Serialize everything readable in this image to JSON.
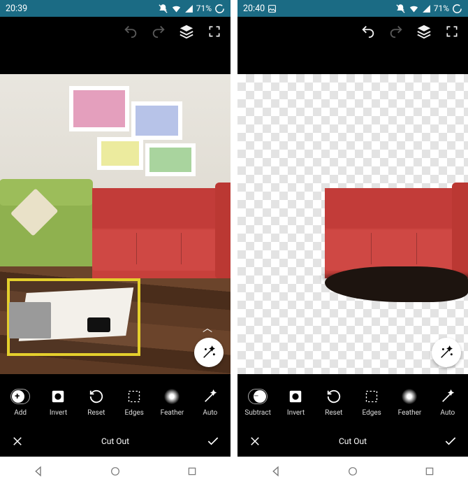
{
  "left": {
    "status": {
      "time": "20:39",
      "battery": "71%"
    },
    "topbar": {
      "undo_enabled": false,
      "redo_enabled": false
    },
    "tools": [
      {
        "id": "add",
        "label": "Add",
        "icon": "pill-plus"
      },
      {
        "id": "invert",
        "label": "Invert",
        "icon": "invert"
      },
      {
        "id": "reset",
        "label": "Reset",
        "icon": "reset"
      },
      {
        "id": "edges",
        "label": "Edges",
        "icon": "edges"
      },
      {
        "id": "feather",
        "label": "Feather",
        "icon": "feather"
      },
      {
        "id": "auto",
        "label": "Auto",
        "icon": "wand"
      }
    ],
    "title": "Cut Out",
    "fab": "magic-wand",
    "show_caret": true
  },
  "right": {
    "status": {
      "time": "20:40",
      "battery": "71%",
      "show_image_icon": true
    },
    "topbar": {
      "undo_enabled": true,
      "redo_enabled": false
    },
    "tools": [
      {
        "id": "subtract",
        "label": "Subtract",
        "icon": "pill-minus"
      },
      {
        "id": "invert",
        "label": "Invert",
        "icon": "invert"
      },
      {
        "id": "reset",
        "label": "Reset",
        "icon": "reset"
      },
      {
        "id": "edges",
        "label": "Edges",
        "icon": "edges"
      },
      {
        "id": "feather",
        "label": "Feather",
        "icon": "feather"
      },
      {
        "id": "auto",
        "label": "Auto",
        "icon": "wand"
      }
    ],
    "title": "Cut Out",
    "fab": "magic-wand",
    "show_caret": false
  }
}
